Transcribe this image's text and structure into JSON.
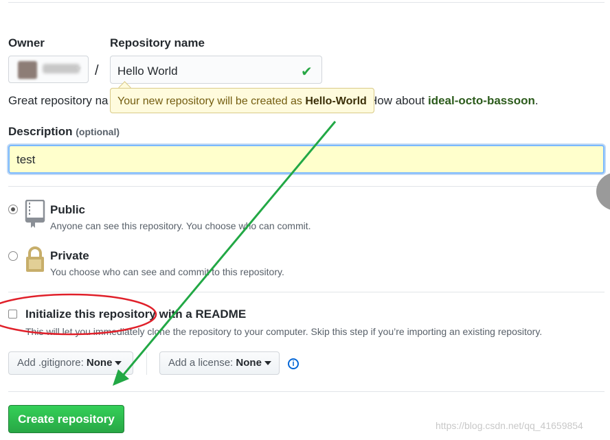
{
  "owner": {
    "label": "Owner"
  },
  "repo": {
    "label": "Repository name",
    "value": "Hello World",
    "separator": "/"
  },
  "hint": {
    "prefix": "Great repository na",
    "suggestion_prefix": "How about ",
    "suggestion": "ideal-octo-bassoon",
    "suffix": "."
  },
  "tooltip": {
    "text": "Your new repository will be created as ",
    "name": "Hello-World"
  },
  "description": {
    "label": "Description",
    "optional": "(optional)",
    "value": "test"
  },
  "visibility": {
    "public": {
      "title": "Public",
      "note": "Anyone can see this repository. You choose who can commit.",
      "selected": true,
      "icon": "repo-icon"
    },
    "private": {
      "title": "Private",
      "note": "You choose who can see and commit to this repository.",
      "selected": false,
      "icon": "lock-icon"
    }
  },
  "readme": {
    "title": "Initialize this repository with a README",
    "note": "This will let you immediately clone the repository to your computer. Skip this step if you’re importing an existing repository.",
    "checked": false
  },
  "gitignore": {
    "key": "Add .gitignore:",
    "value": "None"
  },
  "license": {
    "key": "Add a license:",
    "value": "None"
  },
  "info_icon": "i",
  "create_button": "Create repository",
  "watermark": "https://blog.csdn.net/qq_41659854",
  "colors": {
    "accent_green": "#28a745",
    "annotation_red": "#e0202a",
    "annotation_green": "#22a845",
    "tooltip_bg": "#fffbdd",
    "description_bg": "#ffffcc"
  }
}
